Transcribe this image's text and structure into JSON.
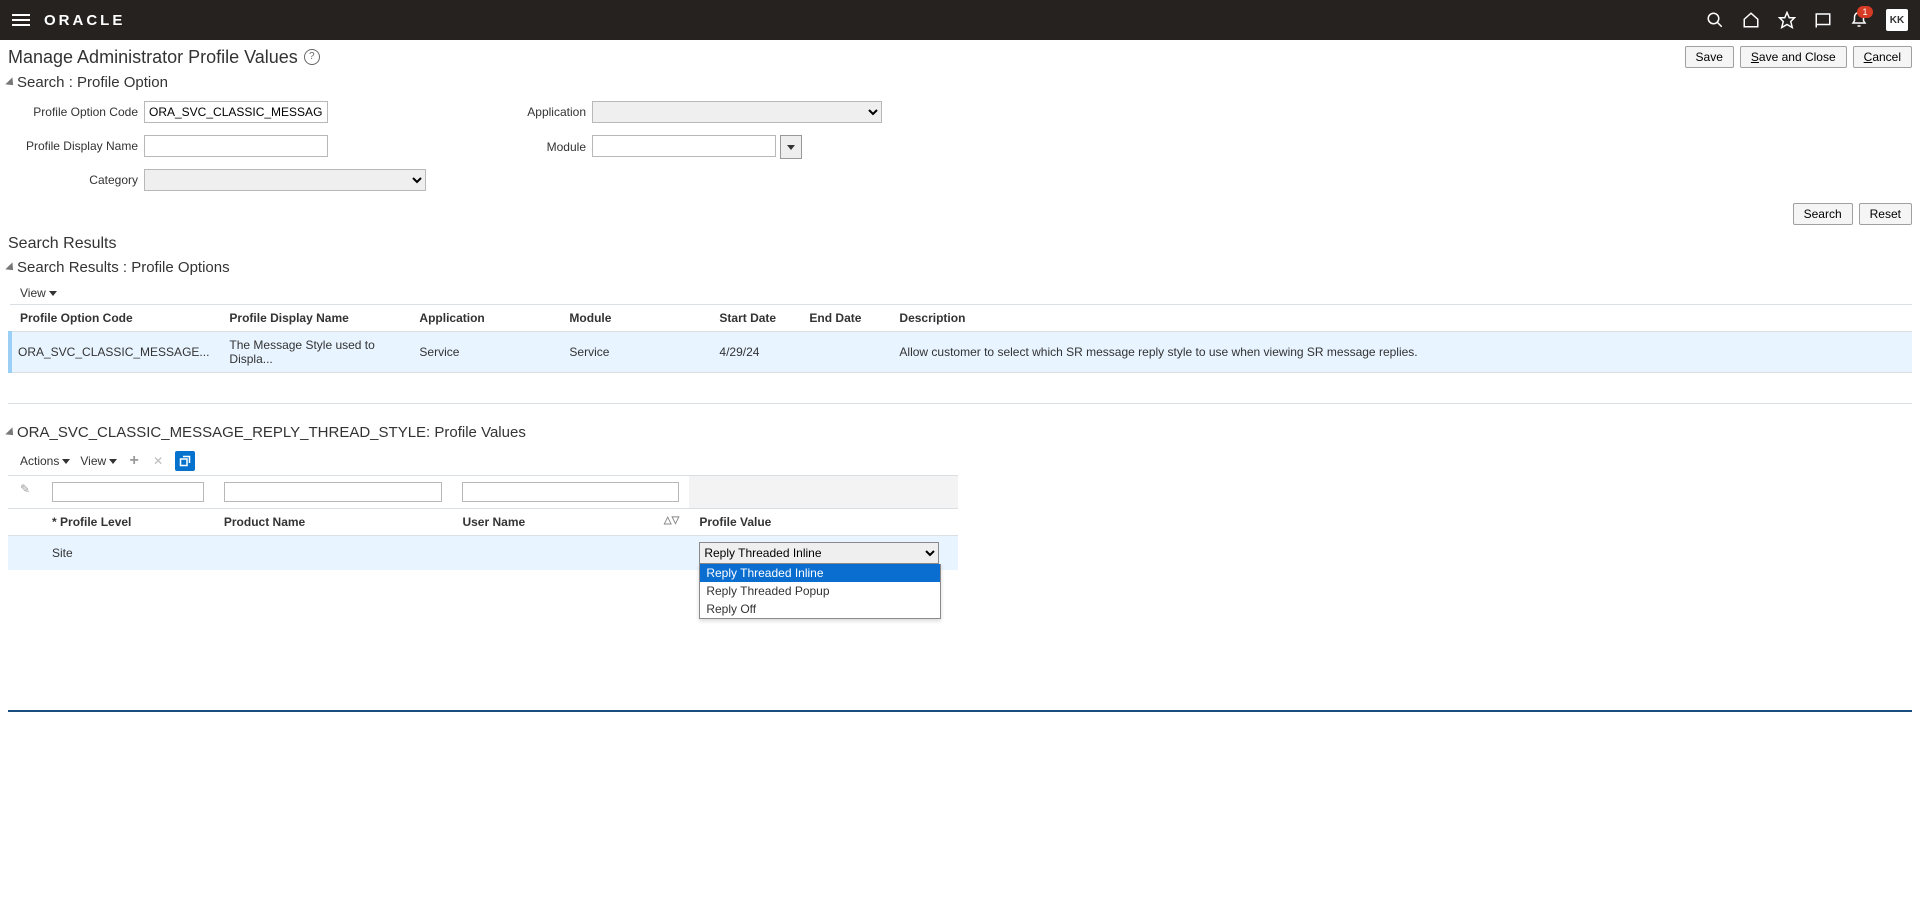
{
  "header": {
    "brand": "ORACLE",
    "notif_count": "1",
    "user_initials": "KK"
  },
  "page_title": "Manage Administrator Profile Values",
  "buttons": {
    "save": "Save",
    "save_close_pre": "S",
    "save_close_rest": "ave and Close",
    "cancel_pre": "C",
    "cancel_rest": "ancel",
    "search": "Search",
    "reset": "Reset"
  },
  "search_section": {
    "title": "Search : Profile Option",
    "labels": {
      "code": "Profile Option Code",
      "display": "Profile Display Name",
      "category": "Category",
      "application": "Application",
      "module": "Module"
    },
    "values": {
      "code": "ORA_SVC_CLASSIC_MESSAGE_RE",
      "display": "",
      "module": ""
    }
  },
  "results": {
    "heading": "Search Results",
    "subheading": "Search Results : Profile Options",
    "menus": {
      "view": "View"
    },
    "columns": {
      "code": "Profile Option Code",
      "display": "Profile Display Name",
      "application": "Application",
      "module": "Module",
      "start": "Start Date",
      "end": "End Date",
      "desc": "Description"
    },
    "row": {
      "code": "ORA_SVC_CLASSIC_MESSAGE...",
      "display": "The Message Style used to Displa...",
      "application": "Service",
      "module": "Service",
      "start": "4/29/24",
      "end": "",
      "desc": "Allow customer to select which SR message reply style to use when viewing SR message replies."
    }
  },
  "values_section": {
    "title": "ORA_SVC_CLASSIC_MESSAGE_REPLY_THREAD_STYLE: Profile Values",
    "menus": {
      "actions": "Actions",
      "view": "View"
    },
    "columns": {
      "level": "Profile Level",
      "product": "Product Name",
      "user": "User Name",
      "value": "Profile Value"
    },
    "row": {
      "level": "Site",
      "product": "",
      "user": "",
      "value_selected": "Reply Threaded Inline"
    },
    "options": [
      "Reply Threaded Inline",
      "Reply Threaded Popup",
      "Reply Off"
    ]
  }
}
